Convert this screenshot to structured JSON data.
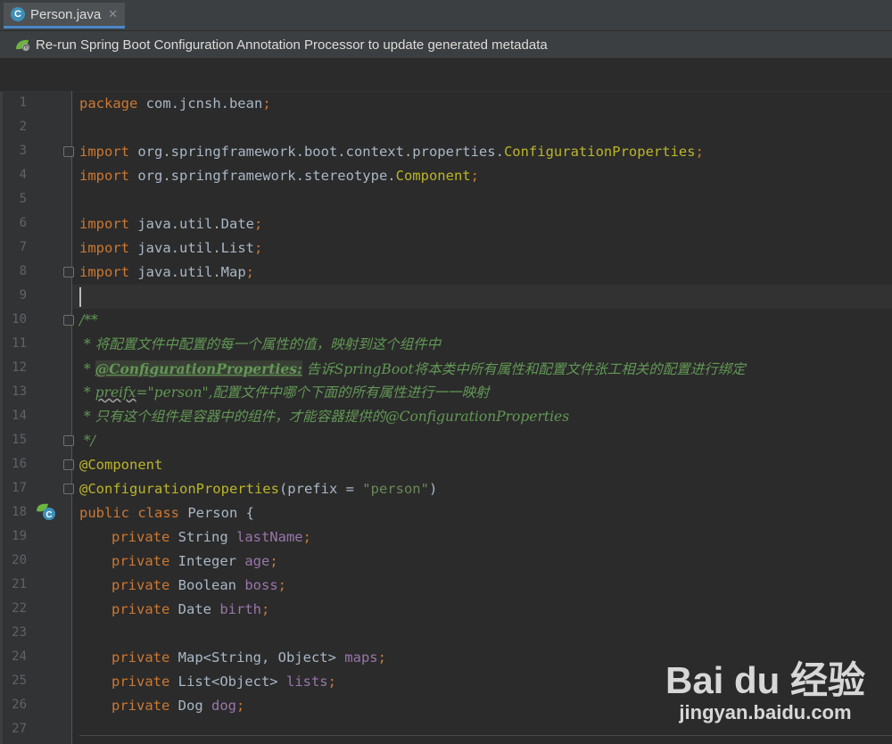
{
  "tab": {
    "label": "Person.java",
    "icon": "C"
  },
  "notification": {
    "text": "Re-run Spring Boot Configuration Annotation Processor to update generated metadata"
  },
  "lines": [
    {
      "n": "1"
    },
    {
      "n": "2"
    },
    {
      "n": "3"
    },
    {
      "n": "4"
    },
    {
      "n": "5"
    },
    {
      "n": "6"
    },
    {
      "n": "7"
    },
    {
      "n": "8"
    },
    {
      "n": "9"
    },
    {
      "n": "10"
    },
    {
      "n": "11"
    },
    {
      "n": "12"
    },
    {
      "n": "13"
    },
    {
      "n": "14"
    },
    {
      "n": "15"
    },
    {
      "n": "16"
    },
    {
      "n": "17"
    },
    {
      "n": "18"
    },
    {
      "n": "19"
    },
    {
      "n": "20"
    },
    {
      "n": "21"
    },
    {
      "n": "22"
    },
    {
      "n": "23"
    },
    {
      "n": "24"
    },
    {
      "n": "25"
    },
    {
      "n": "26"
    },
    {
      "n": "27"
    }
  ],
  "code": {
    "l1": {
      "kw": "package",
      "rest": " com.jcnsh.bean",
      "semi": ";"
    },
    "l3": {
      "kw": "import",
      "rest": " org.springframework.boot.context.properties.",
      "cls": "ConfigurationProperties",
      "semi": ";"
    },
    "l4": {
      "kw": "import",
      "rest": " org.springframework.stereotype.",
      "cls": "Component",
      "semi": ";"
    },
    "l6": {
      "kw": "import",
      "rest": " java.util.Date",
      "semi": ";"
    },
    "l7": {
      "kw": "import",
      "rest": " java.util.List",
      "semi": ";"
    },
    "l8": {
      "kw": "import",
      "rest": " java.util.Map",
      "semi": ";"
    },
    "l10": {
      "text": "/**"
    },
    "l11": {
      "text": " * 将配置文件中配置的每一个属性的值，映射到这个组件中"
    },
    "l12": {
      "pre": " * ",
      "tag": "@ConfigurationProperties:",
      "post": " 告诉SpringBoot将本类中所有属性和配置文件张工相关的配置进行绑定"
    },
    "l13": {
      "pre": " * ",
      "typo": "preifx",
      "post": "=\"person\",配置文件中哪个下面的所有属性进行一一映射"
    },
    "l14": {
      "text": " * 只有这个组件是容器中的组件，才能容器提供的@ConfigurationProperties"
    },
    "l15": {
      "text": " */"
    },
    "l16": {
      "ann": "@Component"
    },
    "l17": {
      "ann": "@ConfigurationProperties",
      "open": "(prefix = ",
      "str": "\"person\"",
      "close": ")"
    },
    "l18": {
      "kw": "public class",
      "rest": " Person {"
    },
    "l19": {
      "kw": "private",
      "type": " String ",
      "field": "lastName",
      "semi": ";"
    },
    "l20": {
      "kw": "private",
      "type": " Integer ",
      "field": "age",
      "semi": ";"
    },
    "l21": {
      "kw": "private",
      "type": " Boolean ",
      "field": "boss",
      "semi": ";"
    },
    "l22": {
      "kw": "private",
      "type": " Date ",
      "field": "birth",
      "semi": ";"
    },
    "l24": {
      "kw": "private",
      "type": " Map<String, Object> ",
      "field": "maps",
      "semi": ";"
    },
    "l25": {
      "kw": "private",
      "type": " List<Object> ",
      "field": "lists",
      "semi": ";"
    },
    "l26": {
      "kw": "private",
      "type": " Dog ",
      "field": "dog",
      "semi": ";"
    }
  },
  "watermark": {
    "logo": "Bai du 经验",
    "url": "jingyan.baidu.com"
  },
  "colors": {
    "keyword": "#cc7832",
    "annotation": "#bbb529",
    "field": "#9876aa",
    "comment": "#629755",
    "string": "#6a8759",
    "text": "#a9b7c6",
    "background": "#2b2b2b"
  }
}
